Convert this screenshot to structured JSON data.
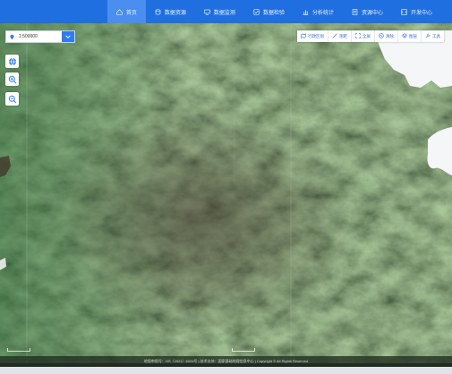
{
  "nav": {
    "items": [
      {
        "label": "首页",
        "icon": "home-icon",
        "active": true
      },
      {
        "label": "数据资源",
        "icon": "database-icon",
        "active": false
      },
      {
        "label": "数据监测",
        "icon": "monitor-icon",
        "active": false
      },
      {
        "label": "数据检验",
        "icon": "check-icon",
        "active": false
      },
      {
        "label": "分析统计",
        "icon": "chart-icon",
        "active": false
      },
      {
        "label": "资源中心",
        "icon": "resource-icon",
        "active": false
      },
      {
        "label": "开发中心",
        "icon": "dev-icon",
        "active": false
      }
    ],
    "color": "#1f6fe0",
    "active_color": "#4a8ef0"
  },
  "scale_selector": {
    "value": "1:500000"
  },
  "right_toolbar": {
    "items": [
      {
        "label": "行政区划",
        "icon": "region-icon"
      },
      {
        "label": "测距",
        "icon": "measure-icon"
      },
      {
        "label": "全屏",
        "icon": "fullscreen-icon"
      },
      {
        "label": "清除",
        "icon": "clear-icon"
      },
      {
        "label": "图层",
        "icon": "layers-icon"
      },
      {
        "label": "工具",
        "icon": "tools-icon"
      }
    ]
  },
  "left_tools": [
    {
      "icon": "globe-icon"
    },
    {
      "icon": "zoom-in-icon"
    },
    {
      "icon": "zoom-out-icon"
    }
  ],
  "footer": {
    "text": "地图审图号：GS（2021）6026号 | 技术支持：国家基础地理信息中心 | Copyright © All Rights Reserved"
  }
}
